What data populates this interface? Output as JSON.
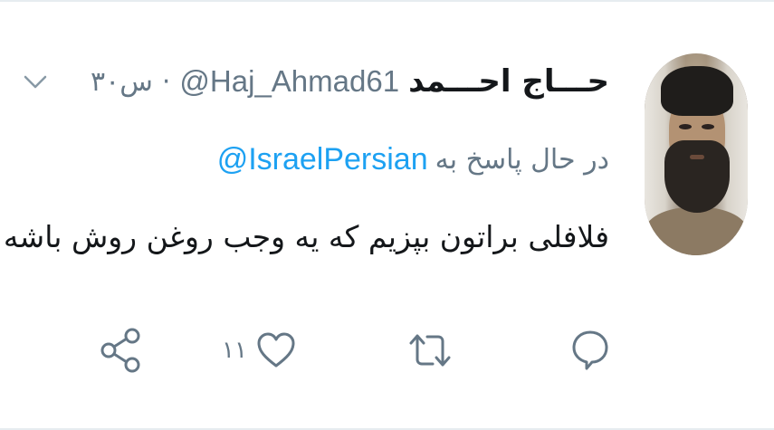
{
  "tweet": {
    "author_name": "حـــاج احـــمد",
    "handle": "@Haj_Ahmad61",
    "separator": "·",
    "time": "۳۰س",
    "reply_prefix": "در حال پاسخ به",
    "reply_mention": "@IsraelPersian",
    "text": "فلافلی براتون بپزیم که یه وجب روغن روش باشه!"
  },
  "actions": {
    "reply_icon": "reply-icon",
    "retweet_icon": "retweet-icon",
    "like_icon": "heart-icon",
    "like_count": "۱۱",
    "share_icon": "share-icon"
  },
  "colors": {
    "text": "#14171a",
    "muted": "#657786",
    "link": "#1da1f2",
    "divider": "#e6ecf0"
  }
}
